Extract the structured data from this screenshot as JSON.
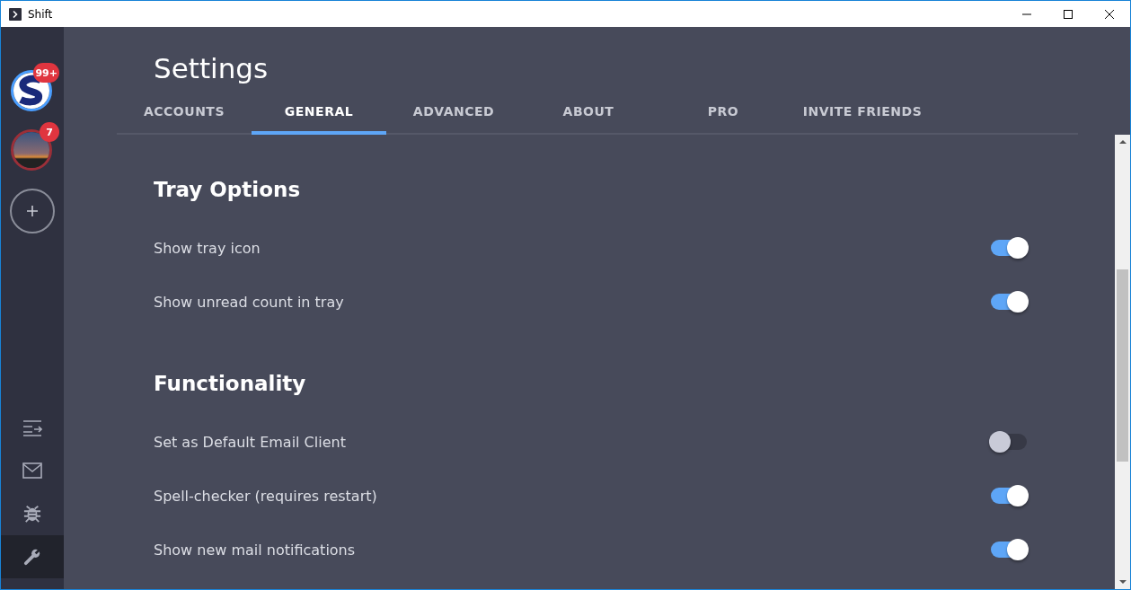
{
  "window": {
    "title": "Shift"
  },
  "sidebar": {
    "accounts": [
      {
        "kind": "logo",
        "badge": "99+",
        "color": "#4a9eff"
      },
      {
        "kind": "photo",
        "badge": "7",
        "color": "#9b2f38"
      }
    ],
    "tools": [
      {
        "kind": "list",
        "selected": false
      },
      {
        "kind": "mail",
        "selected": false
      },
      {
        "kind": "bug",
        "selected": false
      },
      {
        "kind": "wrench",
        "selected": true
      }
    ]
  },
  "page": {
    "title": "Settings"
  },
  "tabs": [
    {
      "label": "ACCOUNTS",
      "selected": false
    },
    {
      "label": "GENERAL",
      "selected": true
    },
    {
      "label": "ADVANCED",
      "selected": false
    },
    {
      "label": "ABOUT",
      "selected": false
    },
    {
      "label": "PRO",
      "selected": false
    },
    {
      "label": "INVITE FRIENDS",
      "selected": false
    }
  ],
  "sections": [
    {
      "heading": "Tray Options",
      "options": [
        {
          "label": "Show tray icon",
          "on": true
        },
        {
          "label": "Show unread count in tray",
          "on": true
        }
      ]
    },
    {
      "heading": "Functionality",
      "options": [
        {
          "label": "Set as Default Email Client",
          "on": false
        },
        {
          "label": "Spell-checker (requires restart)",
          "on": true
        },
        {
          "label": "Show new mail notifications",
          "on": true
        }
      ]
    }
  ]
}
